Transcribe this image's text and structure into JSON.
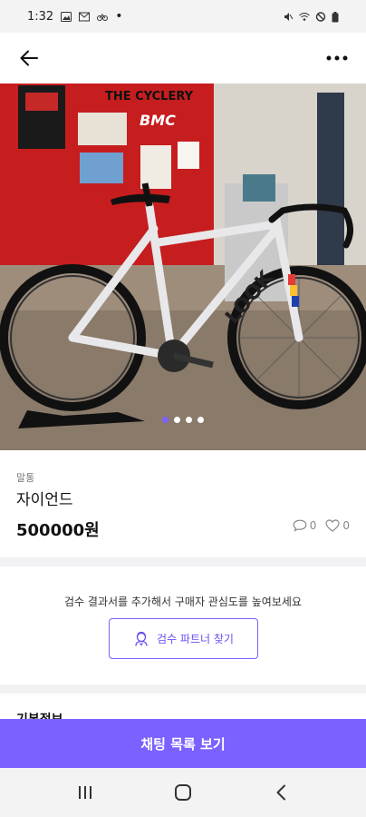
{
  "status_bar": {
    "time": "1:32"
  },
  "product": {
    "category": "말통",
    "title": "자이언드",
    "price": "500000원",
    "comments_count": "0",
    "likes_count": "0",
    "image_count": 4,
    "active_image_index": 0
  },
  "photo": {
    "sign_text": "THE CYCLERY",
    "brand_text": "BMC",
    "frame_text": "LOOK"
  },
  "inspection": {
    "prompt": "검수 결과서를 추가해서 구매자 관심도를 높여보세요",
    "button_label": "검수 파트너 찾기"
  },
  "basic_info_label": "기본정보",
  "chat_button_label": "채팅 목록 보기",
  "colors": {
    "accent": "#7b61ff",
    "divider": "#f2f2f4"
  }
}
